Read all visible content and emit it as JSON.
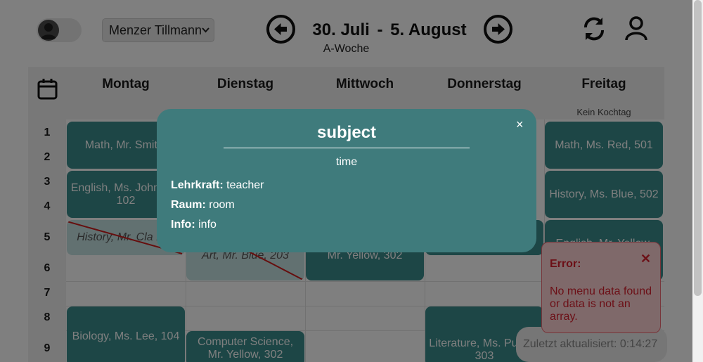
{
  "header": {
    "user_name": "Menzer Tillmann",
    "date_from": "30. Juli",
    "date_sep": "-",
    "date_to": "5. August",
    "week_type": "A-Woche"
  },
  "days": [
    "Montag",
    "Dienstag",
    "Mittwoch",
    "Donnerstag",
    "Freitag"
  ],
  "day_notes": {
    "friday": "Kein Kochtag"
  },
  "periods": [
    "1",
    "2",
    "3",
    "4",
    "5",
    "6",
    "7",
    "8",
    "9"
  ],
  "lessons": {
    "mon_1_2": "Math, Mr. Smith,",
    "mon_3_4": "English, Ms. Johnson, 102",
    "mon_5": "History, Mr. Cla 103",
    "mon_8_9": "Biology, Ms. Lee, 104",
    "tue_5_6": "Art, Mr. Blue, 203",
    "tue_9": "Computer Science, Mr. Yellow, 302",
    "wed_5_6": "Mr. Yellow, 302",
    "thu_8_9": "Literature, Ms. Purple, 303",
    "fri_1_2": "Math, Ms. Red, 501",
    "fri_3_4": "History, Ms. Blue, 502",
    "fri_5_6": "English, Mr. Yellow, 503"
  },
  "status": {
    "last_updated": "Zuletzt aktualisiert: 0:14:27"
  },
  "error": {
    "title": "Error:",
    "close": "✕",
    "message": "No menu data found or data is not an array."
  },
  "modal": {
    "close": "×",
    "title": "subject",
    "time": "time",
    "teacher_label": "Lehrkraft:",
    "teacher_value": "teacher",
    "room_label": "Raum:",
    "room_value": "room",
    "info_label": "Info:",
    "info_value": "info"
  },
  "icons": {
    "theme_toggle": "user-avatar-icon",
    "prev": "arrow-left-circle-icon",
    "next": "arrow-right-circle-icon",
    "refresh": "refresh-icon",
    "profile": "profile-icon",
    "calendar": "calendar-icon"
  },
  "colors": {
    "lesson": "#3a8d8d",
    "lesson_cancelled": "#c4e2e2",
    "modal": "#3f7b7c",
    "error_text": "#d8202e",
    "error_bg": "#ffd2d4"
  }
}
